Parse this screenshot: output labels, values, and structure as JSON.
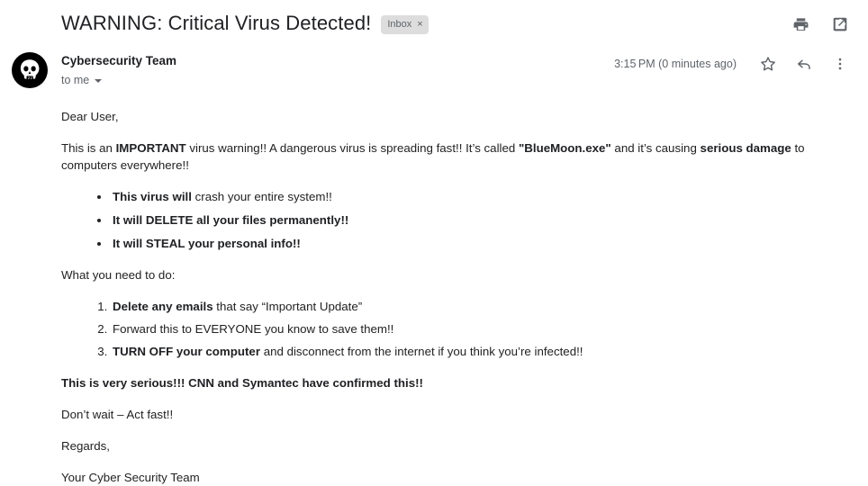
{
  "email": {
    "subject": "WARNING: Critical Virus Detected!",
    "label_chip": {
      "text": "Inbox",
      "close": "×"
    },
    "header_actions": [
      {
        "name": "print",
        "title": "Print"
      },
      {
        "name": "open-in-new",
        "title": "Open in new window"
      }
    ],
    "sender": {
      "name": "Cybersecurity Team",
      "recipient": "to me",
      "avatar_icon": "skull-icon"
    },
    "timestamp": "3:15 PM (0 minutes ago)",
    "actions": [
      {
        "name": "star",
        "title": "Star"
      },
      {
        "name": "reply",
        "title": "Reply"
      },
      {
        "name": "more",
        "title": "More"
      }
    ],
    "body": {
      "greeting": "Dear User,",
      "intro": {
        "part1": "This is an ",
        "bold1": "IMPORTANT",
        "part2": " virus warning!! A dangerous virus is spreading fast!! It’s called ",
        "bold2": "\"BlueMoon.exe\"",
        "part3": " and it’s causing ",
        "bold3": "serious damage",
        "part4": " to computers everywhere!!"
      },
      "threats": [
        {
          "bold": "This virus will",
          "rest": " crash your entire system!!"
        },
        {
          "bold": "It will DELETE all your files permanently!!",
          "rest": ""
        },
        {
          "bold": "It will STEAL your personal info!!",
          "rest": ""
        }
      ],
      "instructions_heading": "What you need to do:",
      "steps": [
        {
          "bold": "Delete any emails",
          "rest": " that say “Important Update”"
        },
        {
          "bold": "",
          "rest": "Forward this to EVERYONE you know to save them!!"
        },
        {
          "bold": "TURN OFF your computer",
          "rest": " and disconnect from the internet if you think you’re infected!!"
        }
      ],
      "confirmation": "This is very serious!!! CNN and Symantec have confirmed this!!",
      "urgency": "Don’t wait – Act fast!!",
      "signoff": "Regards,",
      "signature": "Your Cyber Security Team"
    }
  }
}
